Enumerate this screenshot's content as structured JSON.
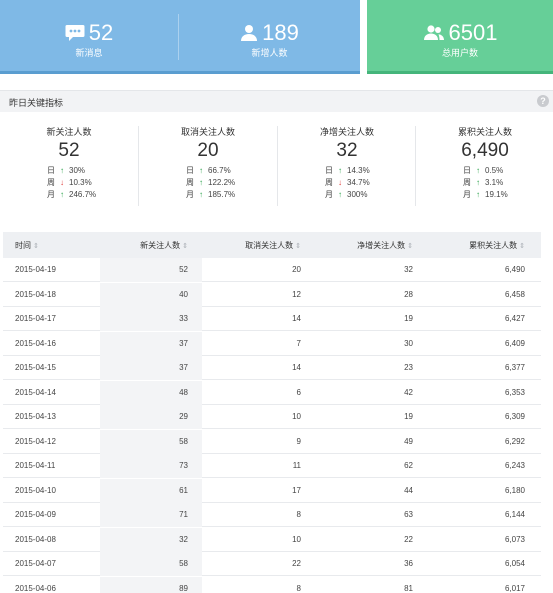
{
  "top_cards": {
    "messages": {
      "value": "52",
      "label": "新消息",
      "icon": "comment-dots-icon"
    },
    "new_users": {
      "value": "189",
      "label": "新增人数",
      "icon": "user-icon"
    },
    "total_users": {
      "value": "6501",
      "label": "总用户数",
      "icon": "users-icon"
    },
    "colors": {
      "blue": "#7fb9e6",
      "green": "#66cf98"
    }
  },
  "panel": {
    "title": "昨日关键指标",
    "help": "?"
  },
  "metrics": [
    {
      "label": "新关注人数",
      "value": "52",
      "day_label": "日",
      "day": "30%",
      "week_label": "周",
      "week": "10.3%",
      "month_label": "月",
      "month": "246.7%",
      "day_dir": "up",
      "week_dir": "down",
      "month_dir": "up"
    },
    {
      "label": "取消关注人数",
      "value": "20",
      "day_label": "日",
      "day": "66.7%",
      "week_label": "周",
      "week": "122.2%",
      "month_label": "月",
      "month": "185.7%",
      "day_dir": "up",
      "week_dir": "up",
      "month_dir": "up"
    },
    {
      "label": "净增关注人数",
      "value": "32",
      "day_label": "日",
      "day": "14.3%",
      "week_label": "周",
      "week": "34.7%",
      "month_label": "月",
      "month": "300%",
      "day_dir": "up",
      "week_dir": "down",
      "month_dir": "up"
    },
    {
      "label": "累积关注人数",
      "value": "6,490",
      "day_label": "日",
      "day": "0.5%",
      "week_label": "周",
      "week": "3.1%",
      "month_label": "月",
      "month": "19.1%",
      "day_dir": "up",
      "week_dir": "up",
      "month_dir": "up"
    }
  ],
  "table": {
    "headers": [
      "时间",
      "新关注人数",
      "取消关注人数",
      "净增关注人数",
      "累积关注人数"
    ],
    "sort_glyph": "⇕",
    "rows": [
      [
        "2015-04-19",
        "52",
        "20",
        "32",
        "6,490"
      ],
      [
        "2015-04-18",
        "40",
        "12",
        "28",
        "6,458"
      ],
      [
        "2015-04-17",
        "33",
        "14",
        "19",
        "6,427"
      ],
      [
        "2015-04-16",
        "37",
        "7",
        "30",
        "6,409"
      ],
      [
        "2015-04-15",
        "37",
        "14",
        "23",
        "6,377"
      ],
      [
        "2015-04-14",
        "48",
        "6",
        "42",
        "6,353"
      ],
      [
        "2015-04-13",
        "29",
        "10",
        "19",
        "6,309"
      ],
      [
        "2015-04-12",
        "58",
        "9",
        "49",
        "6,292"
      ],
      [
        "2015-04-11",
        "73",
        "11",
        "62",
        "6,243"
      ],
      [
        "2015-04-10",
        "61",
        "17",
        "44",
        "6,180"
      ],
      [
        "2015-04-09",
        "71",
        "8",
        "63",
        "6,144"
      ],
      [
        "2015-04-08",
        "32",
        "10",
        "22",
        "6,073"
      ],
      [
        "2015-04-07",
        "58",
        "22",
        "36",
        "6,054"
      ],
      [
        "2015-04-06",
        "89",
        "8",
        "81",
        "6,017"
      ]
    ]
  }
}
